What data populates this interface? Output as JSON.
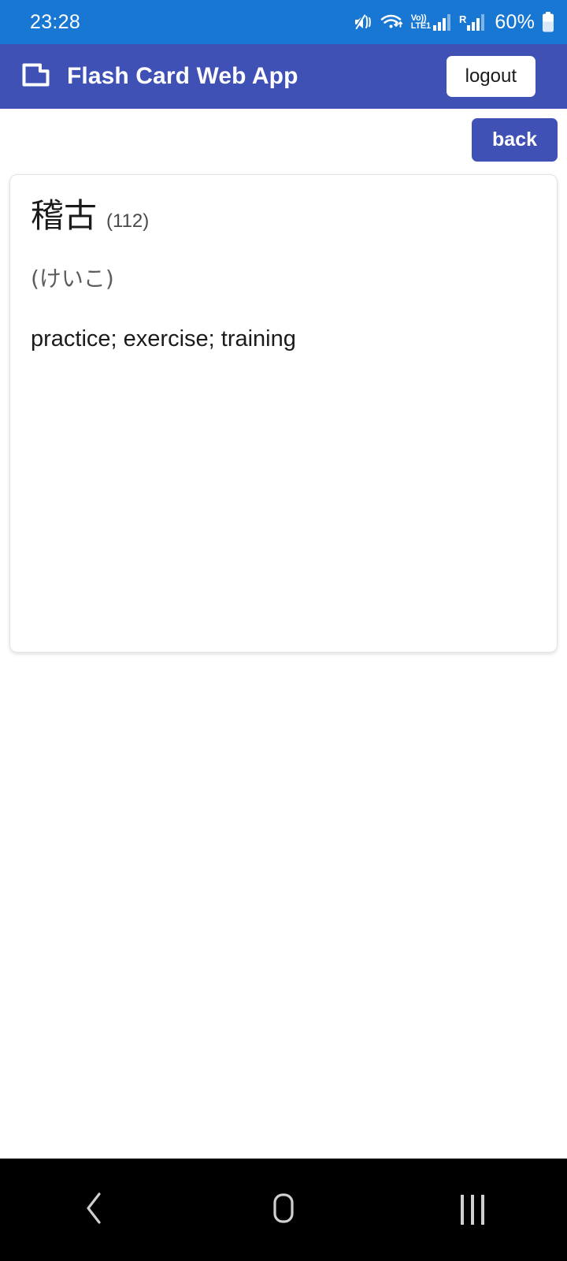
{
  "status_bar": {
    "time": "23:28",
    "battery_percent": "60%",
    "volte_top": "Vo))",
    "volte_bottom": "LTE1",
    "roaming_letter": "R",
    "icons": [
      "mute-vibrate-icon",
      "wifi-icon",
      "volte-signal-icon",
      "roaming-signal-icon",
      "battery-icon"
    ],
    "colors": {
      "background": "#1877d2",
      "foreground": "#ffffff"
    }
  },
  "app_bar": {
    "logo_icon": "flash-card-icon",
    "title": "Flash Card Web App",
    "logout_label": "logout",
    "colors": {
      "background": "#3f51b5",
      "foreground": "#ffffff",
      "button_background": "#ffffff"
    }
  },
  "toolbar": {
    "back_label": "back",
    "back_color": "#3f51b5"
  },
  "flash_card": {
    "term": "稽古",
    "count": "(112)",
    "reading": "(けいこ)",
    "meaning": "practice; exercise; training"
  },
  "nav_bar": {
    "back_icon": "chevron-left-icon",
    "home_icon": "home-square-icon",
    "recents_icon": "recents-bars-icon",
    "background": "#000000"
  }
}
